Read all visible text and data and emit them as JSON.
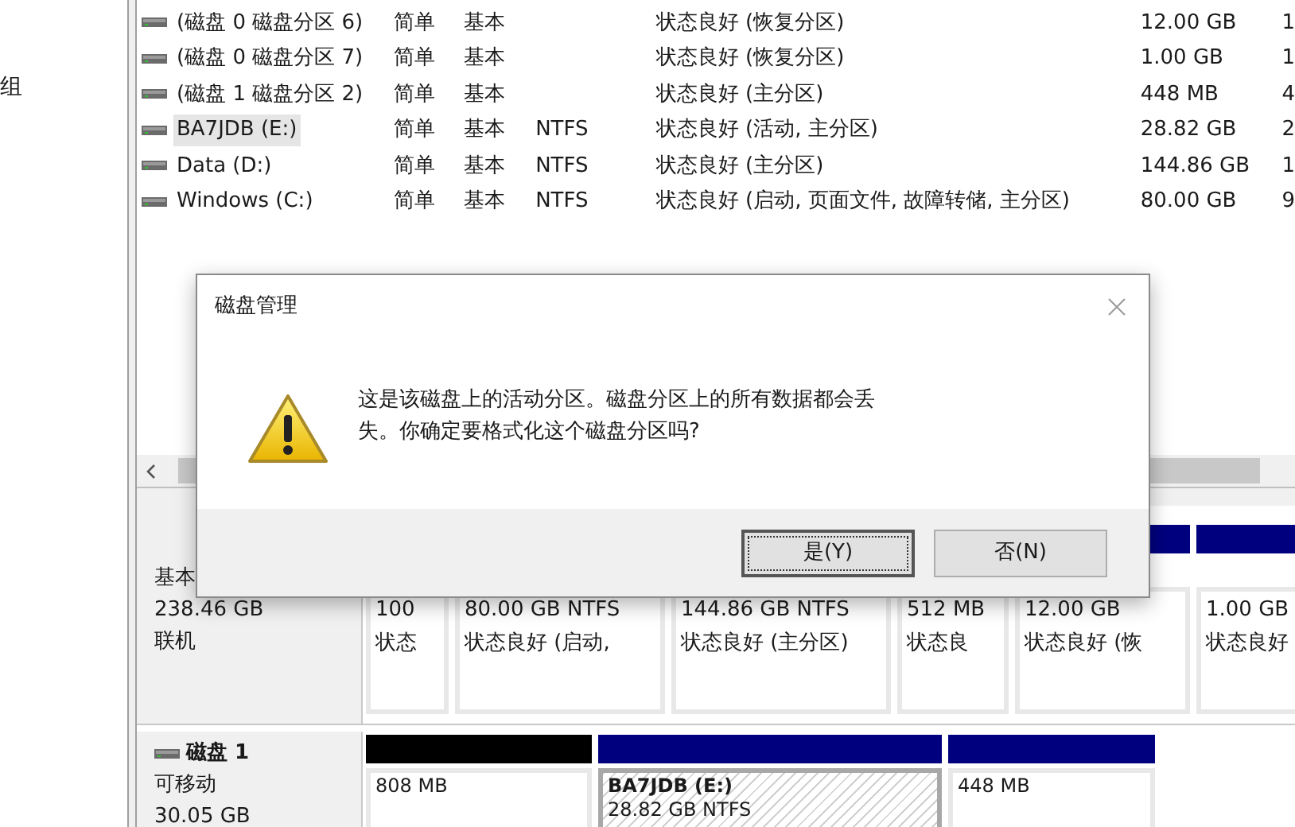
{
  "sidebar": {
    "items": [
      "组"
    ]
  },
  "volumes": [
    {
      "name": "(磁盘 0 磁盘分区 6)",
      "layout": "简单",
      "type": "基本",
      "status": "状态良好 (恢复分区)",
      "capacity": "12.00 GB",
      "column_7": "1",
      "selected": false
    },
    {
      "name": "(磁盘 0 磁盘分区 7)",
      "layout": "简单",
      "type": "基本",
      "status": "状态良好 (恢复分区)",
      "capacity": "1.00 GB",
      "column_7": "1",
      "selected": false
    },
    {
      "name": "(磁盘 1 磁盘分区 2)",
      "layout": "简单",
      "type": "基本",
      "status": "状态良好 (主分区)",
      "capacity": "448 MB",
      "column_7": "4",
      "selected": false
    },
    {
      "name": "BA7JDB (E:)",
      "layout": "简单",
      "type": "基本",
      "file_system": "NTFS",
      "status": "状态良好 (活动, 主分区)",
      "capacity": "28.82 GB",
      "column_7": "2",
      "selected": true
    },
    {
      "name": "Data (D:)",
      "layout": "简单",
      "type": "基本",
      "file_system": "NTFS",
      "status": "状态良好 (主分区)",
      "capacity": "144.86 GB",
      "column_7": "1",
      "selected": false
    },
    {
      "name": "Windows (C:)",
      "layout": "简单",
      "type": "基本",
      "file_system": "NTFS",
      "status": "状态良好 (启动, 页面文件, 故障转储, 主分区)",
      "capacity": "80.00 GB",
      "column_7": "9",
      "selected": false
    }
  ],
  "disks": [
    {
      "type": "基本",
      "size": "238.46 GB",
      "status": "联机",
      "partitions": [
        {
          "size": "100",
          "status": "状态",
          "selected": false
        },
        {
          "size": "80.00 GB NTFS",
          "status": "状态良好 (启动,",
          "selected": false
        },
        {
          "size": "144.86 GB NTFS",
          "status": "状态良好 (主分区)",
          "selected": false
        },
        {
          "size": "512 MB",
          "status": "状态良",
          "selected": false
        },
        {
          "size": "12.00 GB",
          "status": "状态良好 (恢",
          "color": "#00007f",
          "selected": false
        },
        {
          "size": "1.00 GB",
          "status": "状态良好",
          "color": "#00007f",
          "selected": false
        }
      ]
    },
    {
      "label": "磁盘 1",
      "type": "可移动",
      "size": "30.05 GB",
      "partitions": [
        {
          "size": "808 MB",
          "color": "#000000",
          "selected": false
        },
        {
          "name": "BA7JDB  (E:)",
          "size": "28.82 GB NTFS",
          "color": "#00007f",
          "selected": true
        },
        {
          "size": "448 MB",
          "color": "#00007f",
          "selected": false
        }
      ]
    }
  ],
  "dialog": {
    "title": "磁盘管理",
    "message": "这是该磁盘上的活动分区。磁盘分区上的所有数据都会丢失。你确定要格式化这个磁盘分区吗?",
    "buttons": [
      {
        "label": "是(Y)",
        "selected": true
      },
      {
        "label": "否(N)",
        "selected": false
      }
    ]
  }
}
